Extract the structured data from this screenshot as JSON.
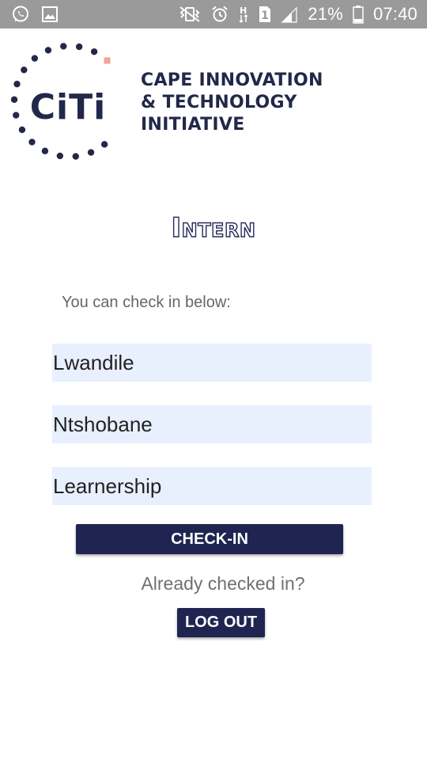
{
  "status_bar": {
    "battery": "21%",
    "time": "07:40",
    "sim_slot": "1",
    "network_type": "H",
    "icons": [
      "whatsapp-icon",
      "gallery-icon",
      "vibrate-icon",
      "alarm-icon",
      "data-h-icon",
      "sim-1-icon",
      "signal-icon",
      "battery-icon"
    ]
  },
  "logo": {
    "mark_text": "CiTi",
    "line1": "CAPE INNOVATION",
    "line2": "& TECHNOLOGY",
    "line3": "INITIATIVE",
    "dot_color": "#222849",
    "accent_color": "#f0a595"
  },
  "title": "Intern",
  "instruction": "You can check in below:",
  "form": {
    "first_name": "Lwandile",
    "last_name": "Ntshobane",
    "program": "Learnership"
  },
  "checkin_label": "CHECK-IN",
  "already_text": "Already checked in?",
  "logout_label": "LOG OUT",
  "colors": {
    "button": "#1f2550",
    "field_bg": "#e8f0fe",
    "status_bar": "#9a9a9a"
  }
}
